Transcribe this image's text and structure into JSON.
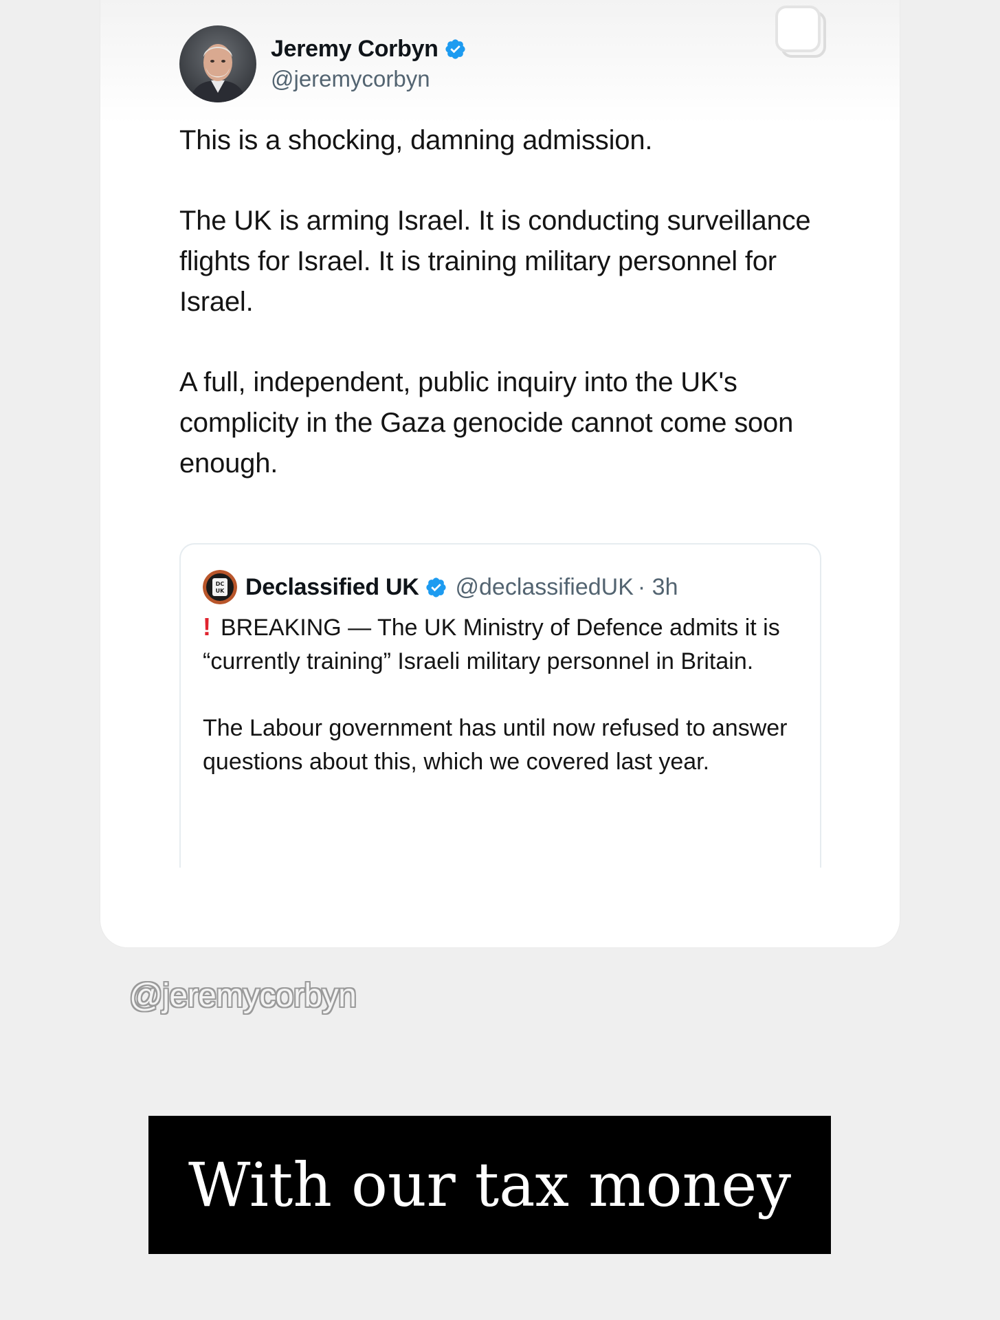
{
  "tweet": {
    "author_name": "Jeremy Corbyn",
    "author_handle": "@jeremycorbyn",
    "paragraphs": [
      "This is a shocking, damning admission.",
      "The UK is arming Israel. It is conducting surveillance flights for Israel. It is training military personnel for Israel.",
      "A full, independent, public inquiry into the UK's complicity in the Gaza genocide cannot come soon enough."
    ],
    "quoted": {
      "author_name": "Declassified UK",
      "author_handle": "@declassifiedUK",
      "time": "· 3h",
      "avatar_text": "DC UK",
      "alert_icon": "!",
      "paragraphs": [
        "BREAKING — The UK Ministry of Defence admits it is “currently training” Israeli military personnel in Britain.",
        "The Labour government has until now refused to answer questions about this, which we covered last year."
      ]
    }
  },
  "watermark": "@jeremycorbyn",
  "caption": "With our tax money",
  "colors": {
    "verified_blue": "#1d9bf0",
    "alert_red": "#e0242f",
    "background": "#efefef",
    "caption_bg": "#000000"
  },
  "icons": {
    "verified": "verified-badge-icon",
    "copy": "copy-icon",
    "alert": "exclamation-icon"
  }
}
